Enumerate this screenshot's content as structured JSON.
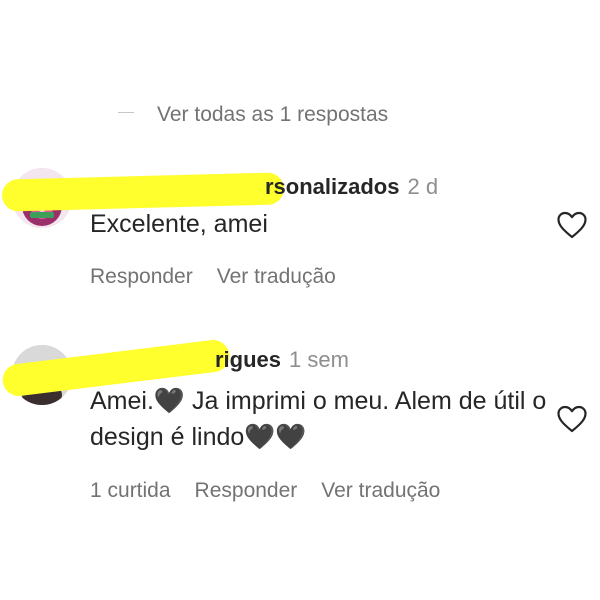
{
  "thread": {
    "view_replies_label": "Ver todas as 1 respostas"
  },
  "comments": [
    {
      "username_visible": "rsonalizados",
      "time": "2 d",
      "text": "Excelente, amei",
      "actions": {
        "reply_label": "Responder",
        "translate_label": "Ver tradução"
      },
      "avatar_colors": [
        "#f3e6ef",
        "#9b2f6a",
        "#3e9f5a"
      ]
    },
    {
      "username_visible": "rigues",
      "time": "1 sem",
      "text": "Amei.🖤 Ja imprimi o meu. Alem de útil o design é lindo🖤🖤",
      "actions": {
        "likes_label": "1 curtida",
        "reply_label": "Responder",
        "translate_label": "Ver tradução"
      }
    }
  ],
  "icons": {
    "like": "heart-outline-icon"
  },
  "colors": {
    "primary_text": "#262626",
    "secondary_text": "#737373",
    "redaction": "#ffff2e"
  }
}
